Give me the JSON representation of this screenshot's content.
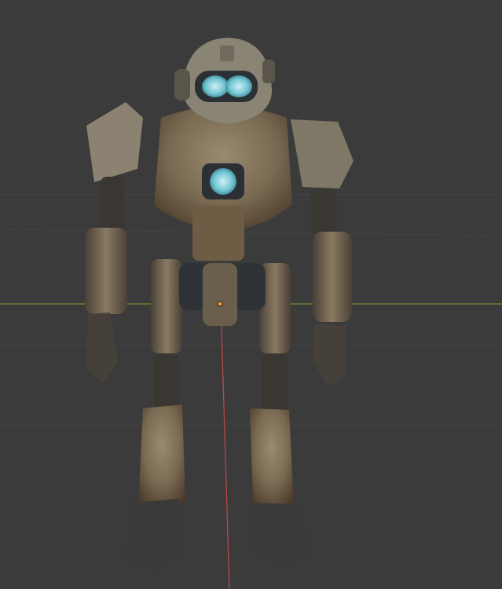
{
  "viewport": {
    "background": "#3b3b3b",
    "grid_color": "#444444",
    "x_axis_color": "#7a9a3a",
    "y_axis_color": "#c04a4a",
    "origin_color": "#f0a020"
  },
  "model": {
    "icon": "robot-model",
    "rust_color": "#7a5a38",
    "metal_color": "#8a8272",
    "dark_joint_color": "#2e3236",
    "eye_color": "#7fd4e0"
  }
}
